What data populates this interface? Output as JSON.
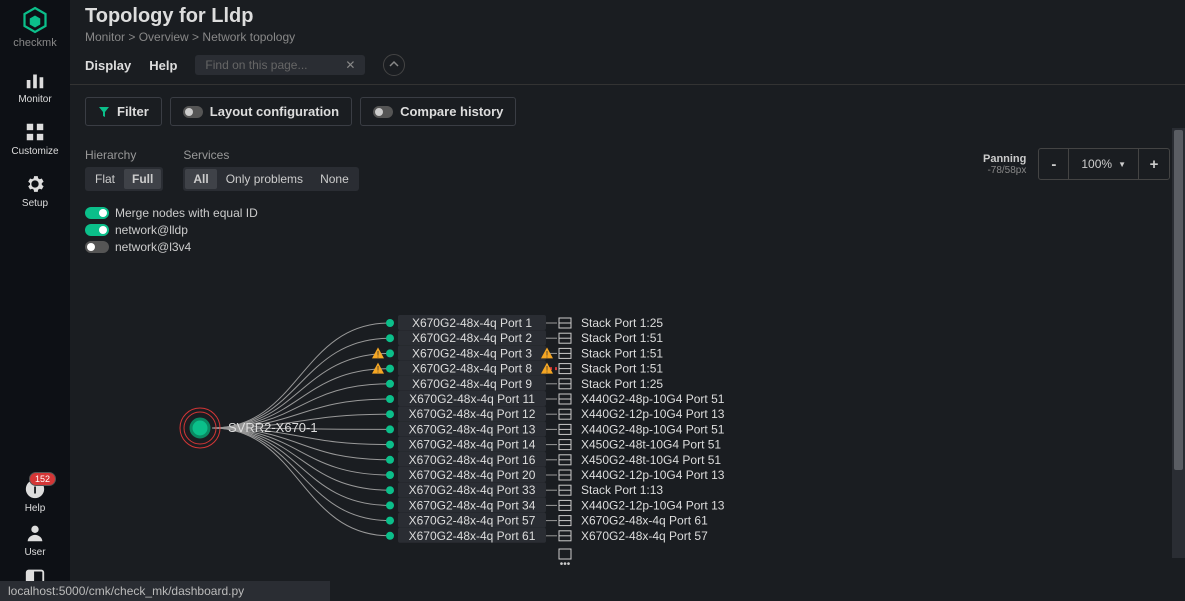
{
  "sidebar": {
    "logo_text": "checkmk",
    "items": [
      {
        "label": "Monitor",
        "name": "monitor"
      },
      {
        "label": "Customize",
        "name": "customize"
      },
      {
        "label": "Setup",
        "name": "setup"
      }
    ],
    "bottom_items": [
      {
        "label": "Help",
        "name": "help",
        "badge": "152"
      },
      {
        "label": "User",
        "name": "user"
      },
      {
        "label": "",
        "name": "sidebar-toggle"
      }
    ]
  },
  "header": {
    "title": "Topology for Lldp",
    "breadcrumb": [
      "Monitor",
      "Overview",
      "Network topology"
    ]
  },
  "menubar": {
    "items": [
      "Display",
      "Help"
    ],
    "search_placeholder": "Find on this page..."
  },
  "toolbar": {
    "filter": "Filter",
    "layout": "Layout configuration",
    "compare": "Compare history"
  },
  "controls": {
    "hierarchy": {
      "label": "Hierarchy",
      "options": [
        "Flat",
        "Full"
      ],
      "active": "Full"
    },
    "services": {
      "label": "Services",
      "options": [
        "All",
        "Only problems",
        "None"
      ],
      "active": "All"
    },
    "toggles": [
      {
        "label": "Merge nodes with equal ID",
        "on": true
      },
      {
        "label": "network@lldp",
        "on": true
      },
      {
        "label": "network@l3v4",
        "on": false
      }
    ],
    "panning": {
      "label": "Panning",
      "value": "-78/58px"
    },
    "zoom": {
      "level": "100%"
    }
  },
  "topology": {
    "root": "SVRR2-X670-1",
    "ports": [
      {
        "src": "X670G2-48x-4q Port 1",
        "dst": "Stack Port 1:25",
        "warn": false
      },
      {
        "src": "X670G2-48x-4q Port 2",
        "dst": "Stack Port 1:51",
        "warn": false
      },
      {
        "src": "X670G2-48x-4q Port 3",
        "dst": "Stack Port 1:51",
        "warn": true
      },
      {
        "src": "X670G2-48x-4q Port 8",
        "dst": "Stack Port 1:51",
        "warn": true,
        "dash": true
      },
      {
        "src": "X670G2-48x-4q Port 9",
        "dst": "Stack Port 1:25",
        "warn": false
      },
      {
        "src": "X670G2-48x-4q Port 11",
        "dst": "X440G2-48p-10G4 Port 51",
        "warn": false
      },
      {
        "src": "X670G2-48x-4q Port 12",
        "dst": "X440G2-12p-10G4 Port 13",
        "warn": false
      },
      {
        "src": "X670G2-48x-4q Port 13",
        "dst": "X440G2-48p-10G4 Port 51",
        "warn": false
      },
      {
        "src": "X670G2-48x-4q Port 14",
        "dst": "X450G2-48t-10G4 Port 51",
        "warn": false
      },
      {
        "src": "X670G2-48x-4q Port 16",
        "dst": "X450G2-48t-10G4 Port 51",
        "warn": false
      },
      {
        "src": "X670G2-48x-4q Port 20",
        "dst": "X440G2-12p-10G4 Port 13",
        "warn": false
      },
      {
        "src": "X670G2-48x-4q Port 33",
        "dst": "Stack Port 1:13",
        "warn": false
      },
      {
        "src": "X670G2-48x-4q Port 34",
        "dst": "X440G2-12p-10G4 Port 13",
        "warn": false
      },
      {
        "src": "X670G2-48x-4q Port 57",
        "dst": "X670G2-48x-4q Port 61",
        "warn": false
      },
      {
        "src": "X670G2-48x-4q Port 61",
        "dst": "X670G2-48x-4q Port 57",
        "warn": false
      }
    ]
  },
  "statusbar": "localhost:5000/cmk/check_mk/dashboard.py"
}
